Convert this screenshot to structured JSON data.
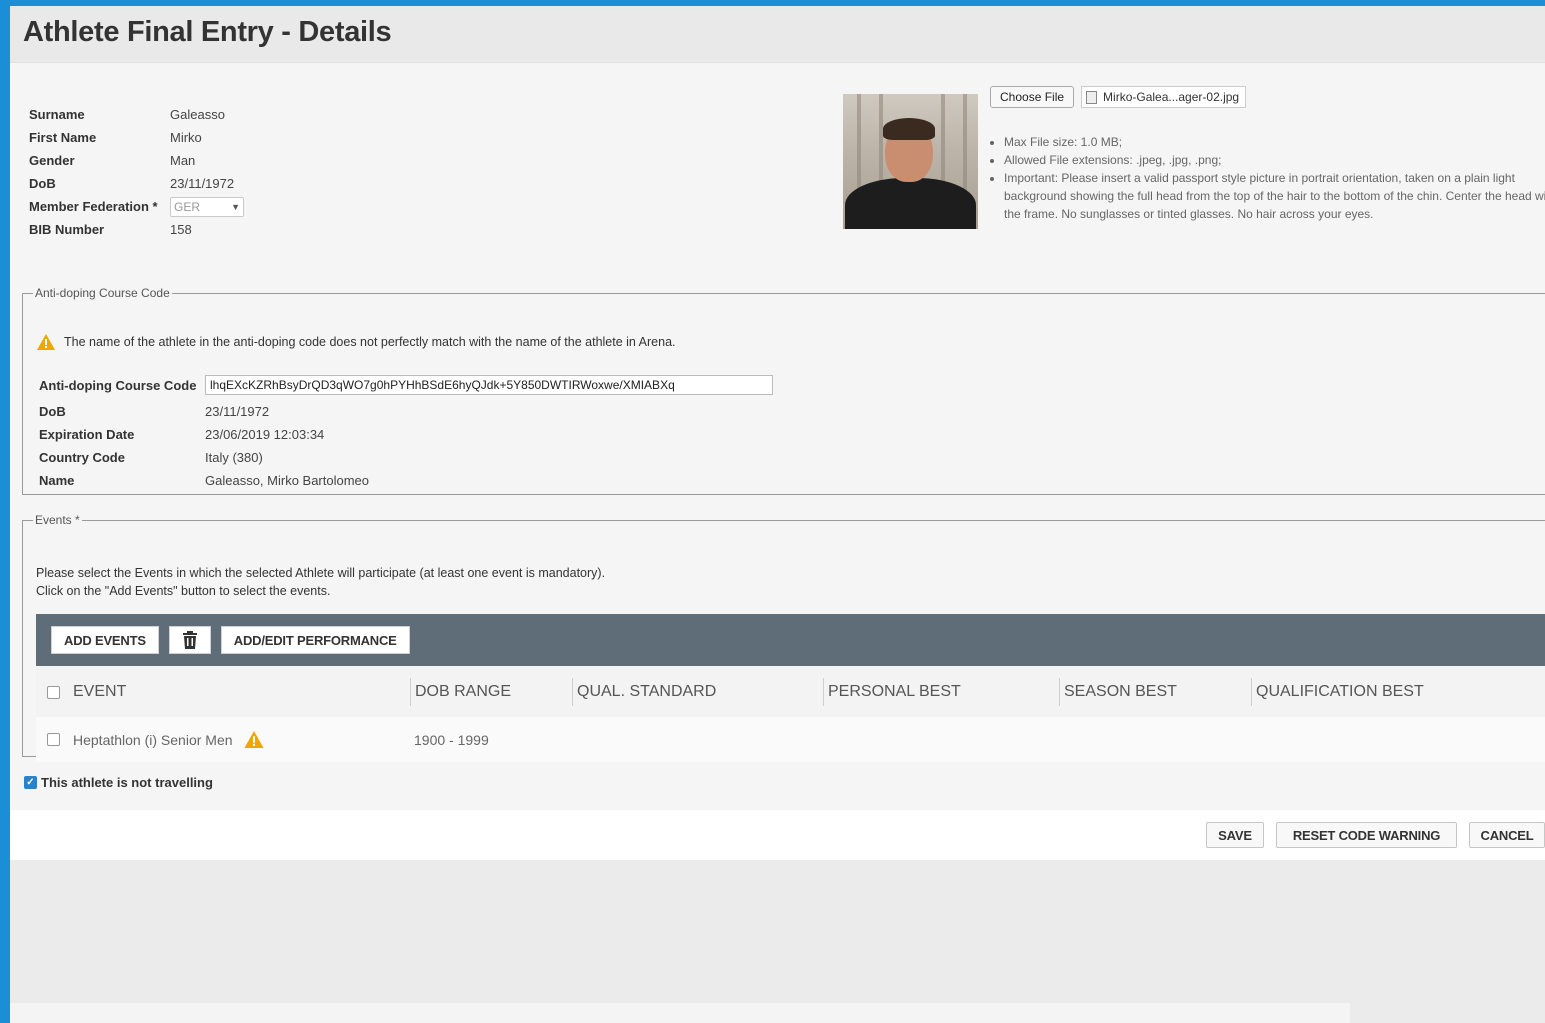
{
  "page_title": "Athlete Final Entry - Details",
  "athlete": {
    "fields": [
      {
        "label": "Surname",
        "value": "Galeasso"
      },
      {
        "label": "First Name",
        "value": "Mirko"
      },
      {
        "label": "Gender",
        "value": "Man"
      },
      {
        "label": "DoB",
        "value": "23/11/1972"
      }
    ],
    "federation_label": "Member Federation *",
    "federation_value": "GER",
    "bib_label": "BIB Number",
    "bib_value": "158"
  },
  "photo_upload": {
    "choose_file_label": "Choose File",
    "file_name": "Mirko-Galea...ager-02.jpg",
    "hints": [
      "Max File size: 1.0 MB;",
      "Allowed File extensions: .jpeg, .jpg, .png;",
      "Important: Please insert a valid passport style picture in portrait orientation, taken on a plain light background showing the full head from the top of the hair to the bottom of the chin. Center the head with the frame. No sunglasses or tinted glasses. No hair across your eyes."
    ]
  },
  "anti_doping": {
    "legend": "Anti-doping Course Code",
    "warning": "The name of the athlete in the anti-doping code does not perfectly match with the name of the athlete in Arena.",
    "code_label": "Anti-doping Course Code",
    "code_value": "lhqEXcKZRhBsyDrQD3qWO7g0hPYHhBSdE6hyQJdk+5Y850DWTIRWoxwe/XMIABXq",
    "rows": [
      {
        "label": "DoB",
        "value": "23/11/1972"
      },
      {
        "label": "Expiration Date",
        "value": "23/06/2019 12:03:34"
      },
      {
        "label": "Country Code",
        "value": "Italy (380)"
      },
      {
        "label": "Name",
        "value": "Galeasso, Mirko Bartolomeo"
      }
    ]
  },
  "events": {
    "legend": "Events *",
    "description_1": "Please select the Events in which the selected Athlete will participate (at least one event is mandatory).",
    "description_2": "Click on the \"Add Events\" button to select the events.",
    "toolbar": {
      "add_events": "ADD EVENTS",
      "delete_icon": "trash-icon",
      "add_edit_performance": "ADD/EDIT PERFORMANCE"
    },
    "columns": [
      "EVENT",
      "DOB RANGE",
      "QUAL. STANDARD",
      "PERSONAL BEST",
      "SEASON BEST",
      "QUALIFICATION BEST"
    ],
    "rows": [
      {
        "event": "Heptathlon (i) Senior Men",
        "dob_range": "1900 - 1999",
        "qual_standard": "",
        "personal_best": "",
        "season_best": "",
        "qualification_best": ""
      }
    ]
  },
  "not_travelling_label": "This athlete is not travelling",
  "actions": {
    "save": "SAVE",
    "reset_code_warning": "RESET CODE WARNING",
    "cancel": "CANCEL"
  },
  "colors": {
    "background_blue": "#1a8fd8",
    "toolbar": "#5f6d78",
    "warning": "#f0a500",
    "checkbox": "#2a82c9"
  }
}
